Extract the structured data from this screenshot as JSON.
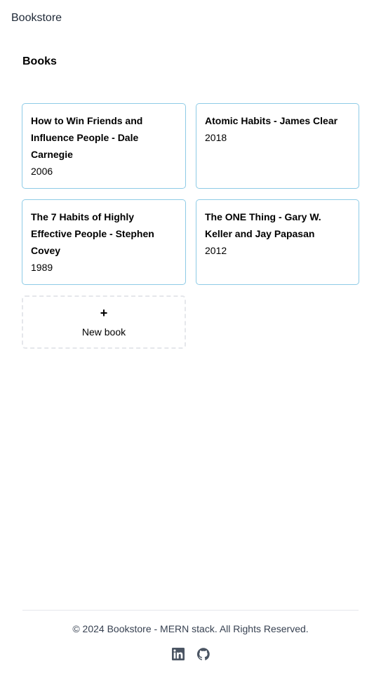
{
  "header": {
    "brand": "Bookstore"
  },
  "main": {
    "title": "Books",
    "books": [
      {
        "title": "How to Win Friends and Influence People - Dale Carnegie",
        "year": "2006"
      },
      {
        "title": "Atomic Habits - James Clear",
        "year": "2018"
      },
      {
        "title": "The 7 Habits of Highly Effective People - Stephen Covey",
        "year": "1989"
      },
      {
        "title": "The ONE Thing - Gary W. Keller and Jay Papasan",
        "year": "2012"
      }
    ],
    "new_book": {
      "icon": "+",
      "label": "New book"
    }
  },
  "footer": {
    "copyright": "© 2024 Bookstore - MERN stack. All Rights Reserved.",
    "social": [
      {
        "icon": "linkedin-icon"
      },
      {
        "icon": "github-icon"
      }
    ]
  },
  "colors": {
    "card_border": "#8ecbe6",
    "dashed_border": "#e5e7eb",
    "footer_text": "#374151",
    "icon": "#4b5563"
  }
}
